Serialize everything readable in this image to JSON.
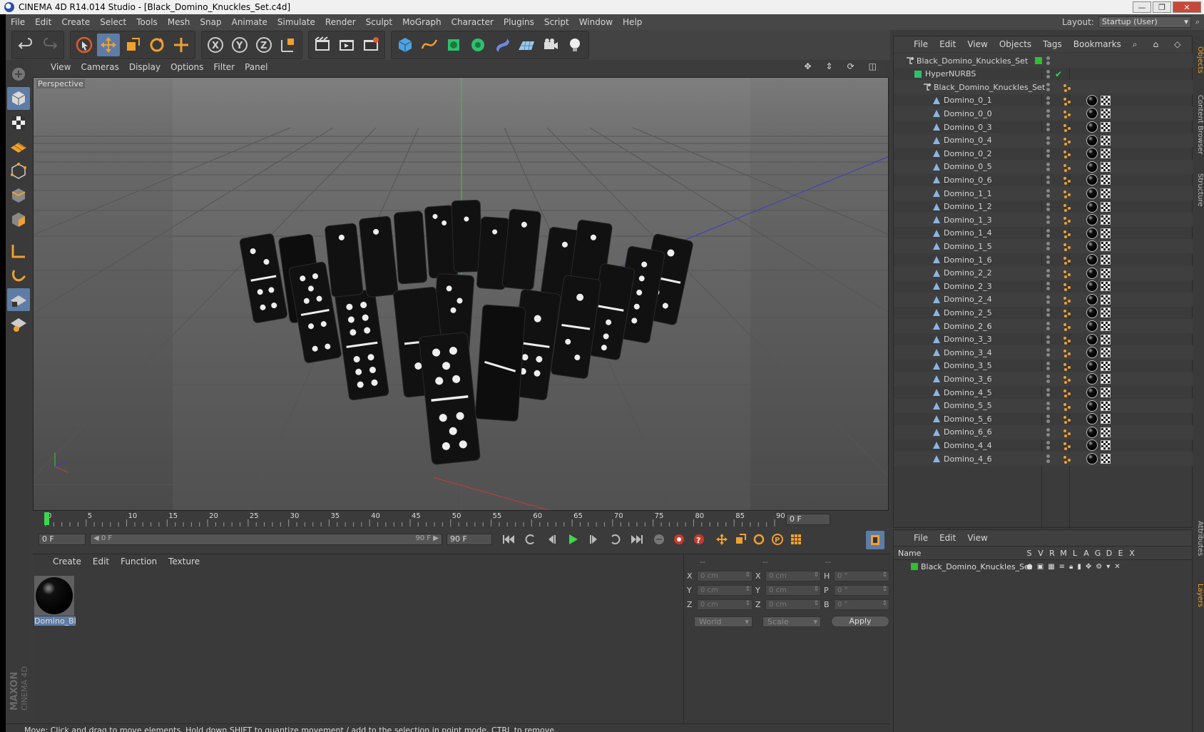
{
  "window": {
    "title": "CINEMA 4D R14.014 Studio - [Black_Domino_Knuckles_Set.c4d]"
  },
  "menubar": [
    "File",
    "Edit",
    "Create",
    "Select",
    "Tools",
    "Mesh",
    "Snap",
    "Animate",
    "Simulate",
    "Render",
    "Sculpt",
    "MoGraph",
    "Character",
    "Plugins",
    "Script",
    "Window",
    "Help"
  ],
  "layout": {
    "label": "Layout:",
    "value": "Startup (User)"
  },
  "viewport": {
    "menu": [
      "View",
      "Cameras",
      "Display",
      "Options",
      "Filter",
      "Panel"
    ],
    "label": "Perspective"
  },
  "timeline": {
    "ticks": [
      "0",
      "5",
      "10",
      "15",
      "20",
      "25",
      "30",
      "35",
      "40",
      "45",
      "50",
      "55",
      "60",
      "65",
      "70",
      "75",
      "80",
      "85",
      "90"
    ],
    "current_frame": "0 F",
    "start_frame": "0 F",
    "range_start": "0 F",
    "range_end": "90 F",
    "end_frame": "90 F"
  },
  "material_panel": {
    "menu": [
      "Create",
      "Edit",
      "Function",
      "Texture"
    ],
    "material_name": "Domino_Bl"
  },
  "coord_panel": {
    "headers": [
      "--",
      "--",
      "--"
    ],
    "rows": [
      {
        "a": "X",
        "v1": "0 cm",
        "b": "X",
        "v2": "0 cm",
        "c": "H",
        "v3": "0 °"
      },
      {
        "a": "Y",
        "v1": "0 cm",
        "b": "Y",
        "v2": "0 cm",
        "c": "P",
        "v3": "0 °"
      },
      {
        "a": "Z",
        "v1": "0 cm",
        "b": "Z",
        "v2": "0 cm",
        "c": "B",
        "v3": "0 °"
      }
    ],
    "space": "World",
    "mode": "Scale",
    "apply": "Apply"
  },
  "status": "Move: Click and drag to move elements. Hold down SHIFT to quantize movement / add to the selection in point mode, CTRL to remove.",
  "object_manager": {
    "menu": [
      "File",
      "Edit",
      "View",
      "Objects",
      "Tags",
      "Bookmarks"
    ],
    "root": "Black_Domino_Knuckles_Set",
    "nurbs": "HyperNURBS",
    "group": "Black_Domino_Knuckles_Set",
    "objects": [
      "Domino_0_1",
      "Domino_0_0",
      "Domino_0_3",
      "Domino_0_4",
      "Domino_0_2",
      "Domino_0_5",
      "Domino_0_6",
      "Domino_1_1",
      "Domino_1_2",
      "Domino_1_3",
      "Domino_1_4",
      "Domino_1_5",
      "Domino_1_6",
      "Domino_2_2",
      "Domino_2_3",
      "Domino_2_4",
      "Domino_2_5",
      "Domino_2_6",
      "Domino_3_3",
      "Domino_3_4",
      "Domino_3_5",
      "Domino_3_6",
      "Domino_4_5",
      "Domino_5_5",
      "Domino_5_6",
      "Domino_6_6",
      "Domino_4_4",
      "Domino_4_6"
    ]
  },
  "layer_manager": {
    "menu": [
      "File",
      "Edit",
      "View"
    ],
    "header_name": "Name",
    "columns": [
      "S",
      "V",
      "R",
      "M",
      "L",
      "A",
      "G",
      "D",
      "E",
      "X"
    ],
    "layer": "Black_Domino_Knuckles_Set"
  },
  "side_tabs": [
    "Objects",
    "Content Browser",
    "Structure",
    "Attributes",
    "Layers"
  ],
  "colors": {
    "accent": "#5e7da6",
    "orange": "#f0a030",
    "layer_green": "#2fbf2f"
  }
}
